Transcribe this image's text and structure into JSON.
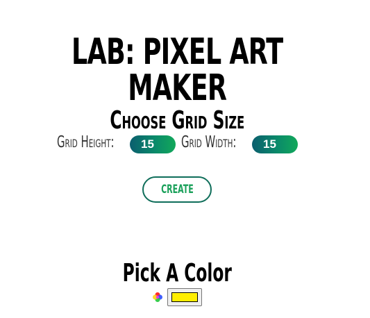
{
  "header": {
    "title": "LAB: PIXEL ART MAKER"
  },
  "grid_section": {
    "heading": "Choose Grid Size",
    "height_label": "Grid Height:",
    "height_value": "15",
    "width_label": "Grid Width:",
    "width_value": "15",
    "create_label": "CREATE"
  },
  "color_section": {
    "heading": "Pick A Color",
    "selected_color": "#ffee00",
    "icon": "color-palette-icon"
  },
  "colors": {
    "accent_gradient_start": "#0b5e6e",
    "accent_gradient_end": "#12a85a",
    "button_text": "#1aa05a",
    "button_border": "#0f6e5a"
  }
}
